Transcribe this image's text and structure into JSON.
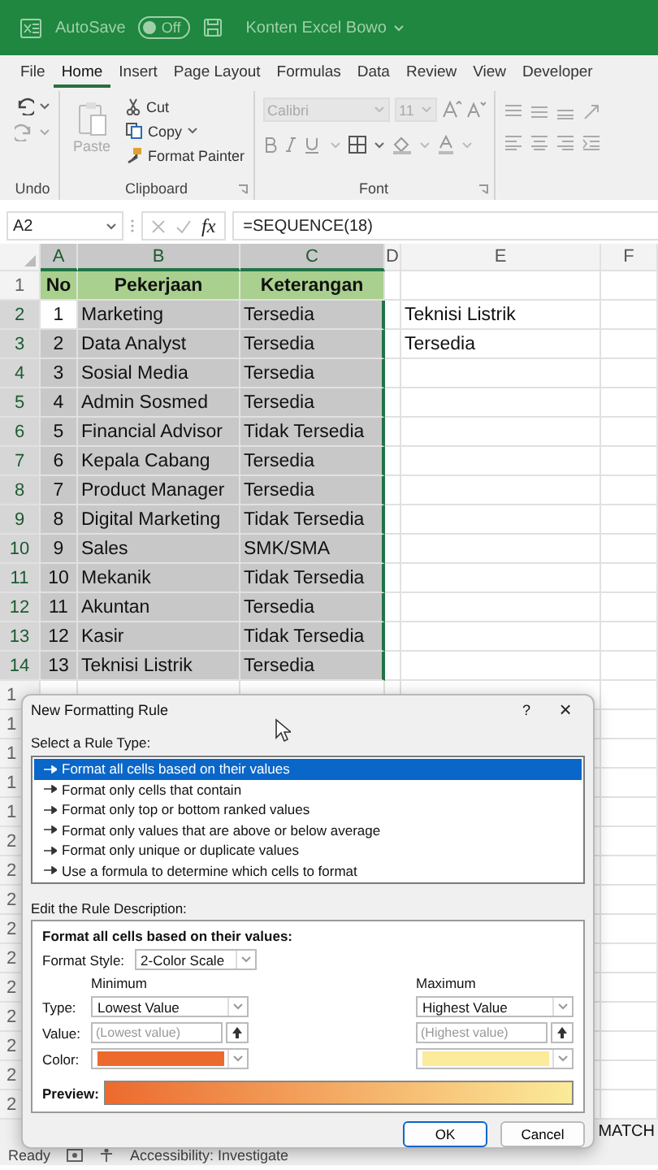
{
  "title_bar": {
    "autosave_label": "AutoSave",
    "autosave": {
      "label": "Off",
      "on": false
    },
    "file_name": "Konten Excel Bowo"
  },
  "ribbon_tabs": [
    {
      "label": "File",
      "selected": false
    },
    {
      "label": "Home",
      "selected": true
    },
    {
      "label": "Insert",
      "selected": false
    },
    {
      "label": "Page Layout",
      "selected": false
    },
    {
      "label": "Formulas",
      "selected": false
    },
    {
      "label": "Data",
      "selected": false
    },
    {
      "label": "Review",
      "selected": false
    },
    {
      "label": "View",
      "selected": false
    },
    {
      "label": "Developer",
      "selected": false
    }
  ],
  "ribbon": {
    "undo_group": {
      "label": "Undo"
    },
    "clipboard_group": {
      "label": "Clipboard",
      "paste": {
        "label": "Paste",
        "disabled": true
      },
      "cut": "Cut",
      "copy": "Copy",
      "format_painter": "Format Painter"
    },
    "font_group": {
      "label": "Font",
      "font_name": {
        "value": "Calibri",
        "disabled": true
      },
      "font_size": {
        "value": "11",
        "disabled": true
      }
    }
  },
  "formula_bar": {
    "name_box": "A2",
    "fx": "fx",
    "formula": "=SEQUENCE(18)"
  },
  "sheet": {
    "columns": [
      "A",
      "B",
      "C",
      "D",
      "E",
      "F"
    ],
    "header_row": {
      "number": "1",
      "cells": [
        "No",
        "Pekerjaan",
        "Keterangan"
      ]
    },
    "rows": [
      {
        "number": "2",
        "no": "1",
        "pekerjaan": "Marketing",
        "keterangan": "Tersedia",
        "column_e": "Teknisi Listrik",
        "selected": true,
        "active": true
      },
      {
        "number": "3",
        "no": "2",
        "pekerjaan": "Data Analyst",
        "keterangan": "Tersedia",
        "column_e": "Tersedia",
        "selected": true,
        "active": false
      },
      {
        "number": "4",
        "no": "3",
        "pekerjaan": "Sosial Media",
        "keterangan": "Tersedia",
        "selected": true,
        "active": false
      },
      {
        "number": "5",
        "no": "4",
        "pekerjaan": "Admin Sosmed",
        "keterangan": "Tersedia",
        "selected": true,
        "active": false
      },
      {
        "number": "6",
        "no": "5",
        "pekerjaan": "Financial Advisor",
        "keterangan": "Tidak Tersedia",
        "selected": true,
        "active": false
      },
      {
        "number": "7",
        "no": "6",
        "pekerjaan": "Kepala Cabang",
        "keterangan": "Tersedia",
        "selected": true,
        "active": false
      },
      {
        "number": "8",
        "no": "7",
        "pekerjaan": "Product Manager",
        "keterangan": "Tersedia",
        "selected": true,
        "active": false
      },
      {
        "number": "9",
        "no": "8",
        "pekerjaan": "Digital Marketing",
        "keterangan": "Tidak Tersedia",
        "selected": true,
        "active": false
      },
      {
        "number": "10",
        "no": "9",
        "pekerjaan": "Sales",
        "keterangan": "SMK/SMA",
        "selected": true,
        "active": false
      },
      {
        "number": "11",
        "no": "10",
        "pekerjaan": "Mekanik",
        "keterangan": "Tidak Tersedia",
        "selected": true,
        "active": false
      },
      {
        "number": "12",
        "no": "11",
        "pekerjaan": "Akuntan",
        "keterangan": "Tersedia",
        "selected": true,
        "active": false
      },
      {
        "number": "13",
        "no": "12",
        "pekerjaan": "Kasir",
        "keterangan": "Tidak Tersedia",
        "selected": true,
        "active": false
      },
      {
        "number": "14",
        "no": "13",
        "pekerjaan": "Teknisi Listrik",
        "keterangan": "Tersedia",
        "selected": true,
        "active": false
      }
    ],
    "covered_row_numbers": [
      "1",
      "1",
      "1",
      "1",
      "1",
      "2",
      "2",
      "2",
      "2",
      "2",
      "2",
      "2",
      "2",
      "2",
      "2"
    ],
    "sheet_tab": "MATCH"
  },
  "status_bar": {
    "ready": "Ready",
    "accessibility": "Accessibility: Investigate"
  },
  "dialog": {
    "title": "New Formatting Rule",
    "help": "?",
    "close": "×",
    "rule_type_label": "Select a Rule Type:",
    "rule_types": [
      {
        "label": "Format all cells based on their values",
        "selected": true
      },
      {
        "label": "Format only cells that contain",
        "selected": false
      },
      {
        "label": "Format only top or bottom ranked values",
        "selected": false
      },
      {
        "label": "Format only values that are above or below average",
        "selected": false
      },
      {
        "label": "Format only unique or duplicate values",
        "selected": false
      },
      {
        "label": "Use a formula to determine which cells to format",
        "selected": false
      }
    ],
    "description_label": "Edit the Rule Description:",
    "description_title": "Format all cells based on their values:",
    "format_style": {
      "label": "Format Style:",
      "value": "2-Color Scale"
    },
    "row_labels": [
      "Type:",
      "Value:",
      "Color:"
    ],
    "minimum": {
      "heading": "Minimum",
      "type": "Lowest Value",
      "value_placeholder": "(Lowest value)",
      "color": "#ec6a2e"
    },
    "maximum": {
      "heading": "Maximum",
      "type": "Highest Value",
      "value_placeholder": "(Highest value)",
      "color": "#fbeb9a"
    },
    "preview_label": "Preview:",
    "ok": "OK",
    "cancel": "Cancel"
  }
}
